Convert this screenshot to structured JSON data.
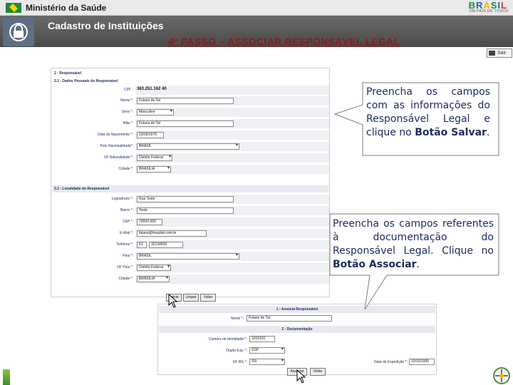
{
  "header": {
    "ministry": "Ministério da Saúde",
    "brand": [
      "B",
      "R",
      "A",
      "S",
      "I",
      "L"
    ],
    "brand_sub": "UM PAÍS DE TODOS"
  },
  "app": {
    "title": "Cadastro de Instituições",
    "step_title": "4º PASSO – ASSOCIAR RESPONSÁVEL LEGAL",
    "exit_label": "Sair"
  },
  "form1": {
    "section_title": "2 - Responsável",
    "personal_title": "2.1 - Dados Pessoais do Responsável",
    "fields": [
      {
        "label": "CPF :",
        "value": "363.251.162 40"
      },
      {
        "label": "Nome *:",
        "value": "Fulano de Tal"
      },
      {
        "label": "Sexo *:",
        "value": "Masculino"
      },
      {
        "label": "Mãe *:",
        "value": "Fulana de Tal"
      },
      {
        "label": "Data de Nascimento *:",
        "value": "13/09/1976"
      },
      {
        "label": "País Nacionalidade*:",
        "value": "BRASIL"
      },
      {
        "label": "UF Naturalidade *:",
        "value": "Distrito Federal"
      },
      {
        "label": "Cidade *:",
        "value": "BRASILIA"
      }
    ],
    "location_title": "2.2 - Localidade do Responsável",
    "location_fields": [
      {
        "label": "Logradouro *:",
        "value": "Rua Teste"
      },
      {
        "label": "Bairro *:",
        "value": "Teste"
      },
      {
        "label": "CEP *:",
        "value": "70000-000"
      },
      {
        "label": "E-Mail *:",
        "value": "fulano@hospital.com.br"
      },
      {
        "label": "Telefone *:",
        "value": "61",
        "value2": "32134500"
      },
      {
        "label": "País *:",
        "value": "BRASIL"
      },
      {
        "label": "UF País *:",
        "value": "Distrito Federal"
      },
      {
        "label": "Cidade *:",
        "value": "BRASILIA"
      }
    ],
    "buttons": [
      "Salvar",
      "Limpar",
      "Voltar"
    ]
  },
  "form2": {
    "section_title": "1 - Associa Responsável",
    "name_label": "Nome *:",
    "name_value": "Fulano de Tal",
    "doc_title": "2 - Documentação",
    "fields": [
      {
        "label": "Carteira de Identidade *:",
        "value": "1010101"
      },
      {
        "label": "Órgão Exp. *:",
        "value": "SSP"
      },
      {
        "label": "UF RG *:",
        "value": "SN"
      }
    ],
    "emission_label": "Data de Expedição *:",
    "emission_value": "10/10/1995",
    "buttons": [
      "Associar",
      "Voltar"
    ]
  },
  "callouts": {
    "first_text": "Preencha os campos com as informações do Responsável Legal e clique no",
    "first_bold": "Botão Salvar",
    "first_end": ".",
    "second_text": "Preencha os campos referentes à documentação do Responsável Legal. Clique no",
    "second_bold": "Botão Associar",
    "second_end": "."
  }
}
